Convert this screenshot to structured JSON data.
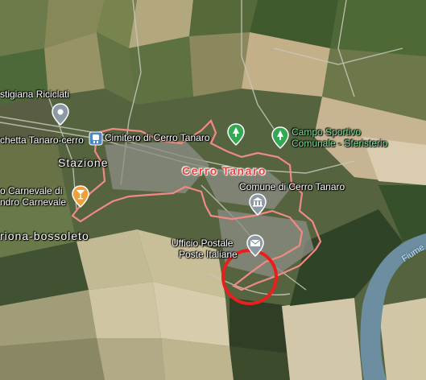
{
  "map": {
    "town_name": "Cerro Tanaro",
    "river_label": "Fiume",
    "labels": {
      "riciclati": "stigiana Riciclati",
      "stazione_stop": "chetta Tanaro-cerro",
      "cimitero": "Cimitero di Cerro Tanaro",
      "stazione": "Stazione",
      "campo_line1": "Campo Sportivo",
      "campo_line2": "Comunale - Sferisterio",
      "comune": "Comune di Cerro Tanaro",
      "carnevale_line1": "o Carnevale di",
      "carnevale_line2": "ndro Carnevale",
      "bossoleto": "riona-bossoleto",
      "ufficio_line1": "Ufficio Postale",
      "ufficio_line2": "Poste Italiane"
    },
    "colors": {
      "boundary": "#f08a84",
      "highlight_circle": "#e8201c",
      "green_pin": "#34a853",
      "gray_pin": "#8c9aa6",
      "orange_pin": "#f0a03a"
    },
    "icons": {
      "recycling": "map-pin-icon",
      "cemetery": "park-pin-icon",
      "sports": "park-pin-icon",
      "comune": "government-pin-icon",
      "post": "post-office-pin-icon",
      "bar": "cocktail-pin-icon",
      "station": "train-station-icon"
    }
  }
}
